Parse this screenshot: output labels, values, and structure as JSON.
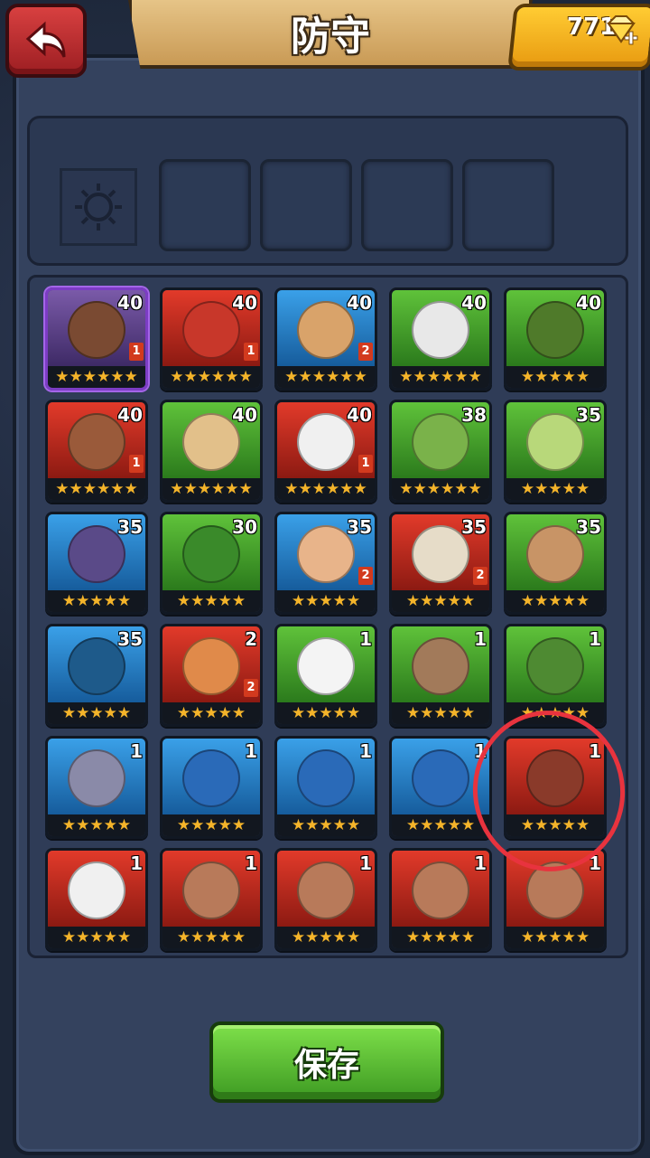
{
  "header": {
    "title": "防守",
    "gem_count": "771",
    "back_icon": "back-arrow-icon",
    "gem_icon": "diamond-plus-icon",
    "colors": {
      "back": "#c2302e",
      "gems": "#f5b21f",
      "title_plate": "#d9b070"
    }
  },
  "defense_slots": [
    {
      "state": "emblem",
      "icon": "sun-emblem-icon"
    },
    {
      "state": "empty"
    },
    {
      "state": "empty"
    },
    {
      "state": "empty"
    },
    {
      "state": "empty"
    }
  ],
  "heroes": [
    {
      "level": "40",
      "badge": "1",
      "stars": 6,
      "color": "purple",
      "face": "#7a4a32"
    },
    {
      "level": "40",
      "badge": "1",
      "stars": 6,
      "color": "red",
      "face": "#c8372a"
    },
    {
      "level": "40",
      "badge": "2",
      "stars": 6,
      "color": "blue",
      "face": "#d9a36a"
    },
    {
      "level": "40",
      "badge": "",
      "stars": 6,
      "color": "green",
      "face": "#e8e8e8"
    },
    {
      "level": "40",
      "badge": "",
      "stars": 5,
      "color": "green",
      "face": "#4f7a2a"
    },
    {
      "level": "40",
      "badge": "1",
      "stars": 6,
      "color": "red",
      "face": "#9a5a3a"
    },
    {
      "level": "40",
      "badge": "",
      "stars": 6,
      "color": "green",
      "face": "#e2c08a"
    },
    {
      "level": "40",
      "badge": "1",
      "stars": 6,
      "color": "red",
      "face": "#f0f0f0"
    },
    {
      "level": "38",
      "badge": "",
      "stars": 6,
      "color": "green",
      "face": "#7ab24a"
    },
    {
      "level": "35",
      "badge": "",
      "stars": 5,
      "color": "green",
      "face": "#b8d87a"
    },
    {
      "level": "35",
      "badge": "",
      "stars": 5,
      "color": "blue",
      "face": "#5a4a88"
    },
    {
      "level": "30",
      "badge": "",
      "stars": 5,
      "color": "green",
      "face": "#3a8a2a"
    },
    {
      "level": "35",
      "badge": "2",
      "stars": 5,
      "color": "blue",
      "face": "#e8b48a"
    },
    {
      "level": "35",
      "badge": "2",
      "stars": 5,
      "color": "red",
      "face": "#e6dcc8"
    },
    {
      "level": "35",
      "badge": "",
      "stars": 5,
      "color": "green",
      "face": "#c89466"
    },
    {
      "level": "35",
      "badge": "",
      "stars": 5,
      "color": "blue",
      "face": "#1e5a8a"
    },
    {
      "level": "2",
      "badge": "2",
      "stars": 5,
      "color": "red",
      "face": "#e08a4a"
    },
    {
      "level": "1",
      "badge": "",
      "stars": 5,
      "color": "green",
      "face": "#f4f4f4"
    },
    {
      "level": "1",
      "badge": "",
      "stars": 5,
      "color": "green",
      "face": "#a27a5a"
    },
    {
      "level": "1",
      "badge": "",
      "stars": 5,
      "color": "green",
      "face": "#4e8a32"
    },
    {
      "level": "1",
      "badge": "",
      "stars": 5,
      "color": "blue",
      "face": "#8a8aa8"
    },
    {
      "level": "1",
      "badge": "",
      "stars": 5,
      "color": "blue",
      "face": "#2a6ab8"
    },
    {
      "level": "1",
      "badge": "",
      "stars": 5,
      "color": "blue",
      "face": "#2a6ab8"
    },
    {
      "level": "1",
      "badge": "",
      "stars": 5,
      "color": "blue",
      "face": "#2a6ab8"
    },
    {
      "level": "1",
      "badge": "",
      "stars": 5,
      "color": "red",
      "face": "#8a3a2a"
    },
    {
      "level": "1",
      "badge": "",
      "stars": 5,
      "color": "red",
      "face": "#f0f0f0"
    },
    {
      "level": "1",
      "badge": "",
      "stars": 5,
      "color": "red",
      "face": "#b87a5a"
    },
    {
      "level": "1",
      "badge": "",
      "stars": 5,
      "color": "red",
      "face": "#b87a5a"
    },
    {
      "level": "1",
      "badge": "",
      "stars": 5,
      "color": "red",
      "face": "#b87a5a"
    },
    {
      "level": "1",
      "badge": "",
      "stars": 5,
      "color": "red",
      "face": "#b87a5a"
    }
  ],
  "save_label": "保存"
}
